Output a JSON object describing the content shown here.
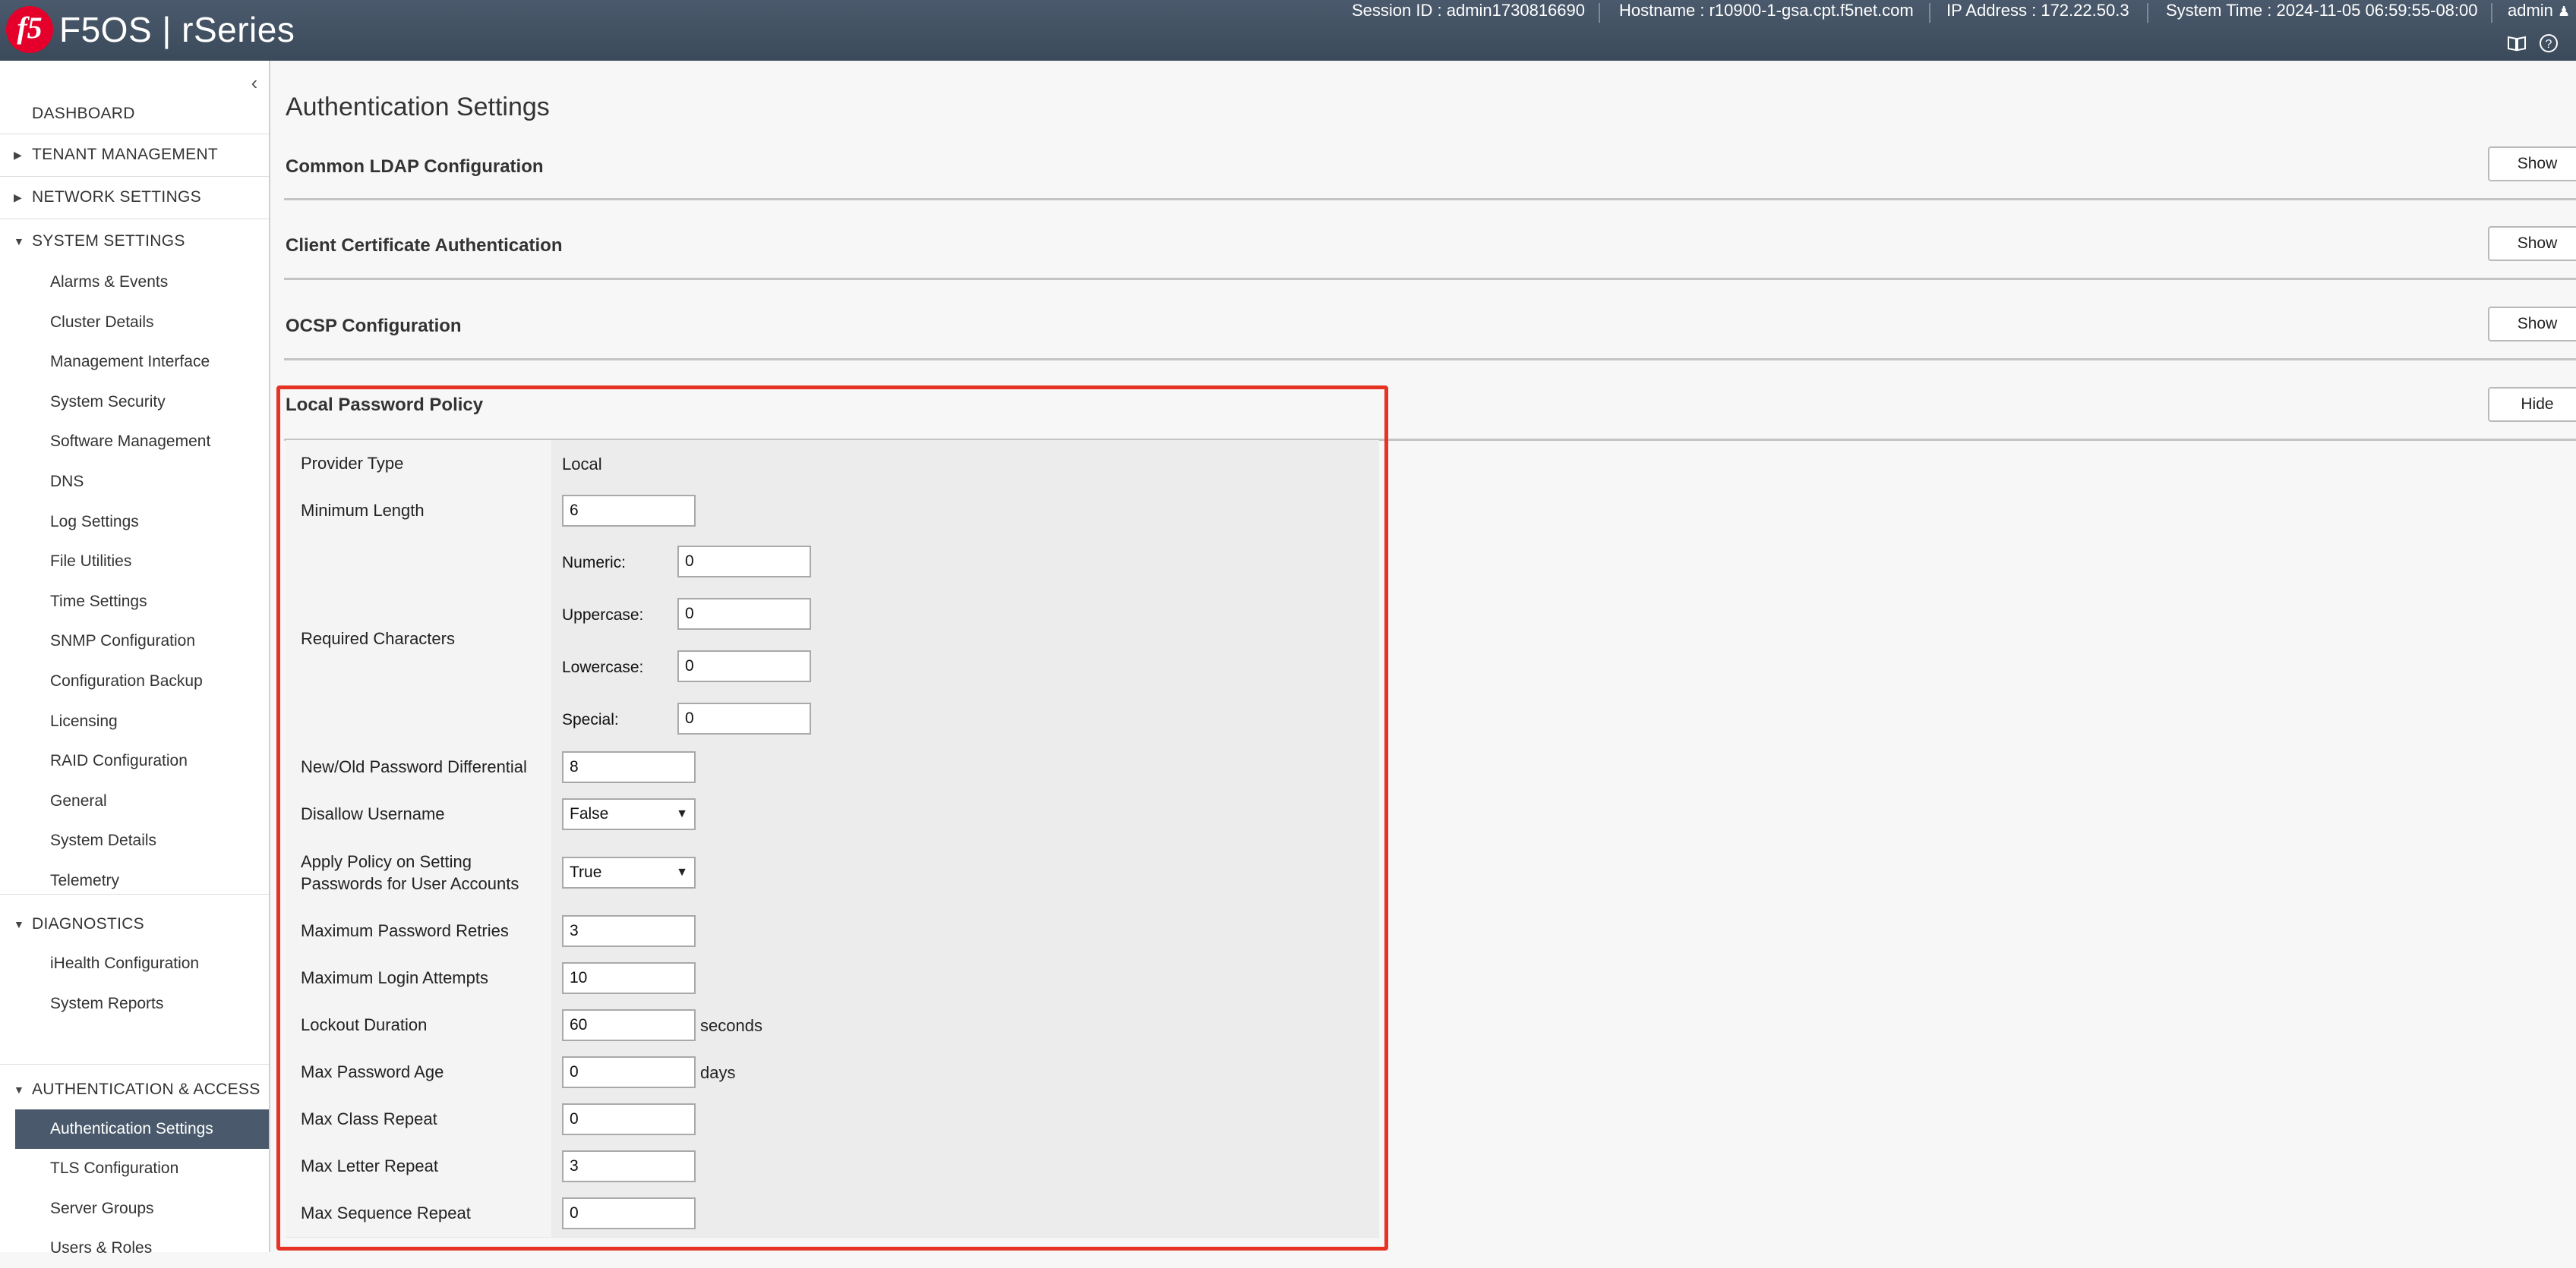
{
  "header": {
    "logo_text": "f5",
    "brand": "F5OS | rSeries",
    "session": "Session ID : admin1730816690",
    "hostname": "Hostname : r10900-1-gsa.cpt.f5net.com",
    "ip": "IP Address : 172.22.50.3",
    "time": "System Time : 2024-11-05 06:59:55-08:00",
    "user": "admin",
    "help_icon": "help-icon",
    "docs_icon": "book-icon"
  },
  "sidebar": {
    "dashboard": "DASHBOARD",
    "tenant": "TENANT MANAGEMENT",
    "network": "NETWORK SETTINGS",
    "system": "SYSTEM SETTINGS",
    "system_items": [
      "Alarms & Events",
      "Cluster Details",
      "Management Interface",
      "System Security",
      "Software Management",
      "DNS",
      "Log Settings",
      "File Utilities",
      "Time Settings",
      "SNMP Configuration",
      "Configuration Backup",
      "Licensing",
      "RAID Configuration",
      "General",
      "System Details",
      "Telemetry"
    ],
    "diagnostics": "DIAGNOSTICS",
    "diag_items": [
      "iHealth Configuration",
      "System Reports"
    ],
    "auth": "AUTHENTICATION & ACCESS",
    "auth_items": [
      "Authentication Settings",
      "TLS Configuration",
      "Server Groups",
      "Users & Roles"
    ],
    "active_item": "Authentication Settings"
  },
  "main": {
    "title": "Authentication Settings",
    "sections": [
      {
        "label": "Common LDAP Configuration",
        "button": "Show"
      },
      {
        "label": "Client Certificate Authentication",
        "button": "Show"
      },
      {
        "label": "OCSP Configuration",
        "button": "Show"
      },
      {
        "label": "Local Password Policy",
        "button": "Hide"
      }
    ],
    "policy": {
      "provider_type_label": "Provider Type",
      "provider_type_value": "Local",
      "min_length_label": "Minimum Length",
      "min_length_value": "6",
      "required_label": "Required Characters",
      "numeric_label": "Numeric:",
      "numeric_value": "0",
      "uppercase_label": "Uppercase:",
      "uppercase_value": "0",
      "lowercase_label": "Lowercase:",
      "lowercase_value": "0",
      "special_label": "Special:",
      "special_value": "0",
      "differential_label": "New/Old Password Differential",
      "differential_value": "8",
      "disallow_label": "Disallow Username",
      "disallow_value": "False",
      "apply_label_1": "Apply Policy on Setting",
      "apply_label_2": "Passwords for User Accounts",
      "apply_value": "True",
      "max_retries_label": "Maximum Password Retries",
      "max_retries_value": "3",
      "max_login_label": "Maximum Login Attempts",
      "max_login_value": "10",
      "lockout_label": "Lockout Duration",
      "lockout_value": "60",
      "lockout_unit": "seconds",
      "max_age_label": "Max Password Age",
      "max_age_value": "0",
      "max_age_unit": "days",
      "class_repeat_label": "Max Class Repeat",
      "class_repeat_value": "0",
      "letter_repeat_label": "Max Letter Repeat",
      "letter_repeat_value": "3",
      "sequence_repeat_label": "Max Sequence Repeat",
      "sequence_repeat_value": "0"
    }
  },
  "colors": {
    "header_bg": "#3b4a5b",
    "active_nav": "#4a5a6c",
    "highlight_border": "#e63323",
    "logo": "#e4002b"
  }
}
